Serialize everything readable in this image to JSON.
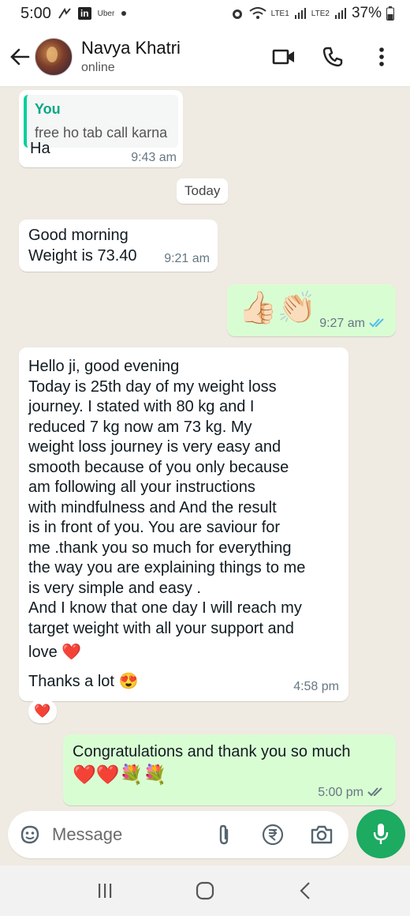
{
  "status_bar": {
    "time": "5:00",
    "notification_app": "Uber",
    "battery": "37%",
    "icons": [
      "gesture-icon",
      "linkedin-icon",
      "alarm-icon",
      "wifi-icon",
      "signal-icon",
      "battery-icon"
    ],
    "linkedin_text": "in",
    "sim1_label": "LTE1",
    "sim2_label": "LTE2"
  },
  "header": {
    "contact_name": "Navya Khatri",
    "contact_status": "online"
  },
  "messages": [
    {
      "direction": "in",
      "reply_to": {
        "author": "You",
        "text": "free ho tab call karna"
      },
      "text": "Ha",
      "time": "9:43 am"
    },
    {
      "date_chip": "Today"
    },
    {
      "direction": "in",
      "lines": [
        "Good morning",
        "Weight is 73.40"
      ],
      "time": "9:21 am"
    },
    {
      "direction": "out",
      "emoji": "👍🏻👏🏻",
      "time": "9:27 am",
      "read": true
    },
    {
      "direction": "in",
      "lines": [
        "Hello ji, good evening",
        "Today is 25th day of my weight loss",
        "journey. I stated with 80 kg and I",
        "reduced 7 kg now am 73 kg. My",
        "weight loss journey is very easy and",
        "smooth because of you only because",
        "am following all your instructions",
        "with mindfulness and And the result",
        "is in front of you. You are saviour for",
        "me .thank you so much for everything",
        "the way you are explaining things to me",
        "is very simple and easy .",
        "And I know that one day I will reach my",
        "target weight with all your support and",
        "love ❤️"
      ],
      "closing": "Thanks a lot 😍",
      "time": "4:58 pm",
      "reaction": "❤️"
    },
    {
      "direction": "out",
      "text": "Congratulations and thank you so much",
      "emoji": "❤️❤️💐💐",
      "time": "5:00 pm",
      "read": false
    }
  ],
  "input": {
    "placeholder": "Message"
  },
  "colors": {
    "chat_background": "#efeae2",
    "incoming_bubble": "#ffffff",
    "outgoing_bubble": "#d9fdd3",
    "accent_green": "#1daa61",
    "read_tick_blue": "#53bdeb",
    "reply_bar": "#06cf9c"
  }
}
